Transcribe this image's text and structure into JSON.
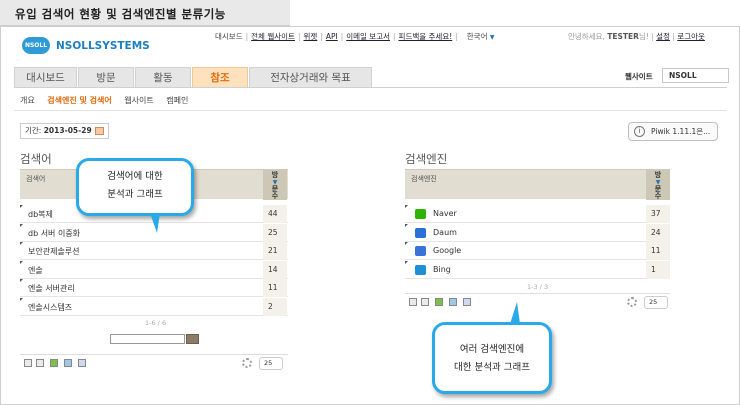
{
  "page_title": "유입 검색어 현황 및 검색엔진별 분류기능",
  "logo": {
    "badge": "NSOLL",
    "name": "NSOLLSYSTEMS"
  },
  "top_links": [
    "대시보드",
    "전체 웹사이트",
    "위젯",
    "API",
    "이메일 보고서",
    "피드백을 주세요!"
  ],
  "language": "한국어",
  "user": {
    "greeting": "안녕하세요,",
    "name": "TESTER",
    "suffix": "님!",
    "settings": "설정",
    "logout": "로그아웃"
  },
  "tabs": [
    "대시보드",
    "방문",
    "활동",
    "참조",
    "전자상거래와 목표"
  ],
  "active_tab": "참조",
  "website": {
    "label": "웹사이트",
    "value": "NSOLL"
  },
  "subnav": [
    "개요",
    "검색엔진 및 검색어",
    "웹사이트",
    "캠페인"
  ],
  "period": {
    "label": "기간:",
    "value": "2013-05-29"
  },
  "piwik_version": "Piwik 1.11.1은...",
  "keywords": {
    "title": "검색어",
    "col_label": "검색어",
    "col_visits": [
      "방",
      "문",
      "수"
    ],
    "rows": [
      {
        "label": "db복제",
        "value": "44"
      },
      {
        "label": "db 서버 이중화",
        "value": "25"
      },
      {
        "label": "보안관제솔루션",
        "value": "21"
      },
      {
        "label": "엔솔",
        "value": "14"
      },
      {
        "label": "엔솔 서버관리",
        "value": "11"
      },
      {
        "label": "엔솔시스템즈",
        "value": "2"
      }
    ],
    "pager": "1-6 / 6",
    "limit": "25"
  },
  "engines": {
    "title": "검색엔진",
    "col_label": "검색엔진",
    "col_visits": [
      "방",
      "문",
      "수"
    ],
    "rows": [
      {
        "label": "Naver",
        "value": "37",
        "icon": "naver-icon",
        "color": "#2db400"
      },
      {
        "label": "Daum",
        "value": "24",
        "icon": "daum-icon",
        "color": "#2b6fd6"
      },
      {
        "label": "Google",
        "value": "11",
        "icon": "google-icon",
        "color": "#3a72d8"
      },
      {
        "label": "Bing",
        "value": "1",
        "icon": "bing-icon",
        "color": "#1e8fd6"
      }
    ],
    "pager": "1-3 / 3",
    "limit": "25"
  },
  "callouts": {
    "keywords": [
      "검색어에 대한",
      "분석과 그래프"
    ],
    "engines": [
      "여러 검색엔진에",
      "대한 분석과 그래프"
    ]
  },
  "colors": {
    "accent": "#e06b10",
    "callout_border": "#29a9e8",
    "header_bg": "#e1ddd0"
  }
}
